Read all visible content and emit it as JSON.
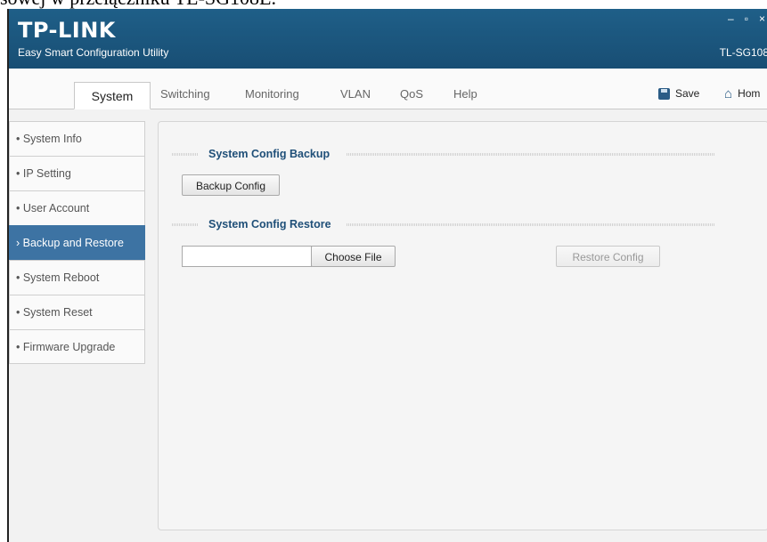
{
  "document": {
    "fragment_text": "sowej w przełączniku TL-SG108E."
  },
  "titlebar": {
    "logo": "TP-LINK",
    "subtitle": "Easy Smart Configuration Utility",
    "model": "TL-SG108",
    "minimize_glyph": "–",
    "maximize_glyph": "▫",
    "close_glyph": "×"
  },
  "tabs": [
    {
      "label": "System",
      "active": true
    },
    {
      "label": "Switching",
      "active": false
    },
    {
      "label": "Monitoring",
      "active": false
    },
    {
      "label": "VLAN",
      "active": false
    },
    {
      "label": "QoS",
      "active": false
    },
    {
      "label": "Help",
      "active": false
    }
  ],
  "toolbar": {
    "save_label": "Save",
    "home_label": "Hom",
    "save_icon": "save-icon",
    "home_icon": "home-icon"
  },
  "sidebar": {
    "items": [
      {
        "label": "• System Info",
        "active": false
      },
      {
        "label": "• IP Setting",
        "active": false
      },
      {
        "label": "• User Account",
        "active": false
      },
      {
        "label": "› Backup and Restore",
        "active": true
      },
      {
        "label": "• System Reboot",
        "active": false
      },
      {
        "label": "• System Reset",
        "active": false
      },
      {
        "label": "• Firmware Upgrade",
        "active": false
      }
    ]
  },
  "main": {
    "backup": {
      "title": "System Config Backup",
      "button_label": "Backup Config"
    },
    "restore": {
      "title": "System Config Restore",
      "file_value": "",
      "choose_file_label": "Choose File",
      "restore_button_label": "Restore Config",
      "restore_enabled": false
    }
  },
  "colors": {
    "titlebar": "#1f5f88",
    "accent_active_sidebar": "#3d73a3",
    "section_title": "#1f4f78"
  }
}
